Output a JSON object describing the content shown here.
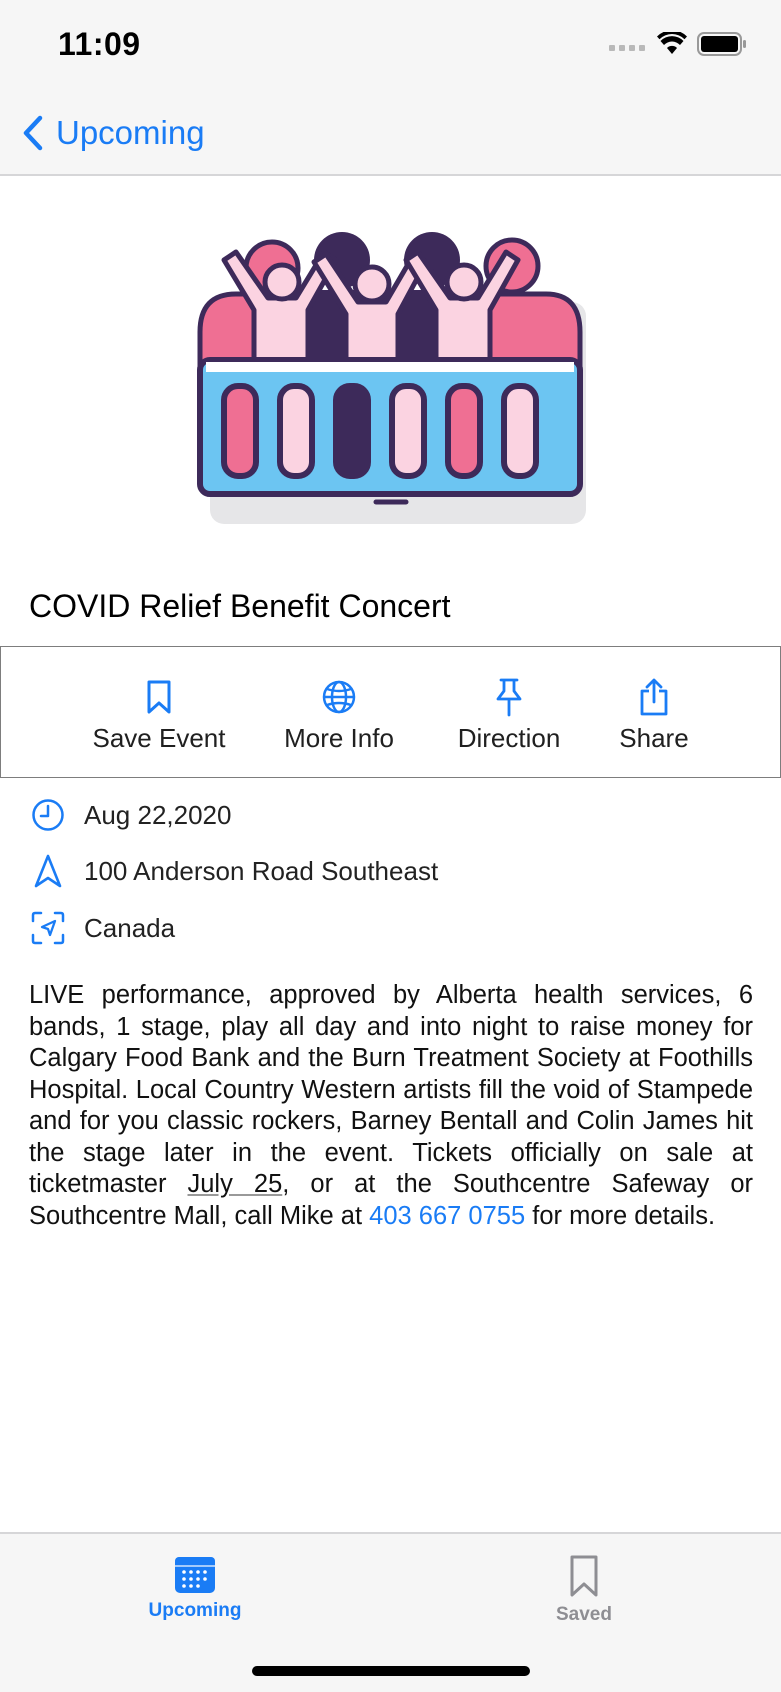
{
  "status": {
    "time": "11:09"
  },
  "nav": {
    "back_label": "Upcoming"
  },
  "event": {
    "title": "COVID Relief Benefit Concert"
  },
  "actions": [
    {
      "label": "Save Event",
      "icon": "bookmark-icon"
    },
    {
      "label": "More Info",
      "icon": "globe-icon"
    },
    {
      "label": "Direction",
      "icon": "pin-icon"
    },
    {
      "label": "Share",
      "icon": "share-icon"
    }
  ],
  "details": {
    "date": "Aug 22,2020",
    "address": "100 Anderson Road Southeast",
    "country": "Canada"
  },
  "description": {
    "part1": "LIVE performance, approved by Alberta health services, 6 bands, 1 stage, play all day and into night to raise money for Calgary Food Bank and the Burn Treatment Society at Foothills Hospital.  Local Country Western artists fill the void of Stampede and for you classic rockers, Barney Bentall and Colin James hit the stage later in the event. Tickets officially on sale at ticketmaster ",
    "date_link": "July 25",
    "part2": ", or at the Southcentre Safeway or Southcentre Mall, call Mike at ",
    "phone": "403 667 0755",
    "part3": " for more details."
  },
  "tabs": [
    {
      "label": "Upcoming",
      "active": true
    },
    {
      "label": "Saved",
      "active": false
    }
  ],
  "colors": {
    "accent": "#1a7cf5",
    "inactive": "#8e8e93"
  }
}
